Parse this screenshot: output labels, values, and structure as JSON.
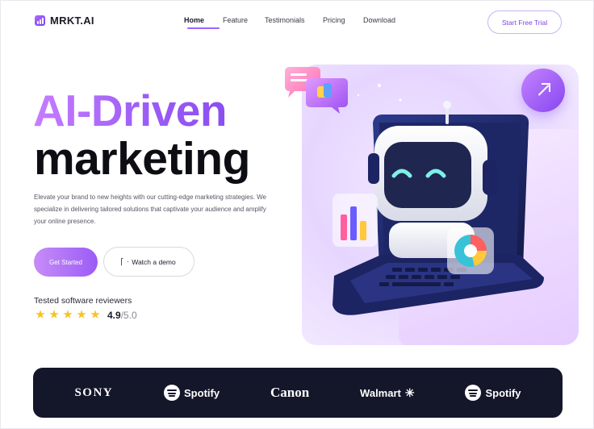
{
  "brand": {
    "name": "MRKT.AI",
    "accent": "#9b5cf6",
    "dark": "#14162a"
  },
  "nav": {
    "items": [
      {
        "label": "Home",
        "active": true
      },
      {
        "label": "Feature",
        "active": false
      },
      {
        "label": "Testimonials",
        "active": false
      },
      {
        "label": "Pricing",
        "active": false
      },
      {
        "label": "Download",
        "active": false
      }
    ],
    "cta": "Start Free Trial"
  },
  "hero": {
    "headline_1": "AI-Driven",
    "headline_2": "marketing",
    "lead": "Elevate your brand to new heights with our cutting-edge marketing strategies. We specialize in delivering tailored solutions that captivate your audience and amplify your online presence.",
    "primary_cta": "Get Started",
    "secondary_cta": "Watch a demo",
    "reviewers_label": "Tested software reviewers",
    "stars": 5,
    "rating": "4.9",
    "rating_max": "/5.0"
  },
  "icons": {
    "arrow": "arrow-up-right-icon",
    "play": "play-icon",
    "star": "star-icon"
  },
  "partners": [
    {
      "name": "SONY",
      "style": "sony"
    },
    {
      "name": "Spotify",
      "style": "spotify"
    },
    {
      "name": "Canon",
      "style": "canon"
    },
    {
      "name": "Walmart",
      "style": "walmart"
    },
    {
      "name": "Spotify",
      "style": "spotify"
    }
  ]
}
